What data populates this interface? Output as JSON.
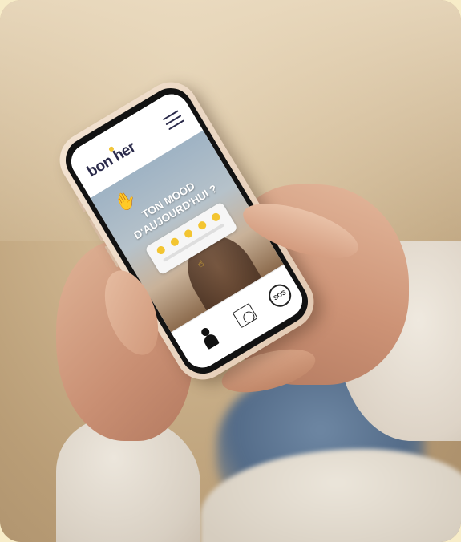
{
  "app": {
    "logo_text": "bon  her",
    "menu_icon": "hamburger-menu-icon"
  },
  "hero": {
    "wave_icon": "waving-hand-icon",
    "title_line1": "TON MOOD",
    "title_line2": "D'AUJOURD'HUI ?"
  },
  "mood": {
    "emoji_count": 5,
    "selector_icon": "pointing-hand-icon"
  },
  "bottom_nav": {
    "profile_icon": "profile-icon",
    "calendar_icon": "calendar-clock-icon",
    "sos_icon": "sos-icon",
    "sos_label": "SOS"
  },
  "colors": {
    "accent_yellow": "#f3c531",
    "logo_navy": "#2a2a4a",
    "phone_case": "#f0dfcc"
  }
}
